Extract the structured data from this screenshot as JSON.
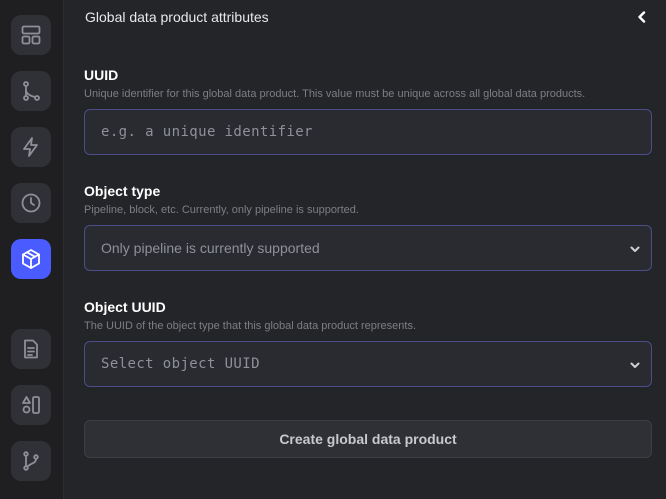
{
  "header": {
    "title": "Global data product attributes",
    "collapse_icon": "chevron-left-icon"
  },
  "sidebar": {
    "items": [
      {
        "icon": "layout-icon",
        "active": false
      },
      {
        "icon": "branch-icon",
        "active": false
      },
      {
        "icon": "lightning-icon",
        "active": false
      },
      {
        "icon": "clock-icon",
        "active": false
      },
      {
        "icon": "cube-icon",
        "active": true
      },
      {
        "icon": "document-icon",
        "active": false
      },
      {
        "icon": "shapes-icon",
        "active": false
      },
      {
        "icon": "git-branch-icon",
        "active": false
      }
    ],
    "active_color": "#4a5cff"
  },
  "form": {
    "uuid": {
      "label": "UUID",
      "description": "Unique identifier for this global data product. This value must be unique across all global data products.",
      "placeholder": "e.g. a unique identifier",
      "value": ""
    },
    "object_type": {
      "label": "Object type",
      "description": "Pipeline, block, etc. Currently, only pipeline is supported.",
      "selected": "Only pipeline is currently supported"
    },
    "object_uuid": {
      "label": "Object UUID",
      "description": "The UUID of the object type that this global data product represents.",
      "selected": "Select object UUID"
    },
    "submit_label": "Create global data product"
  }
}
